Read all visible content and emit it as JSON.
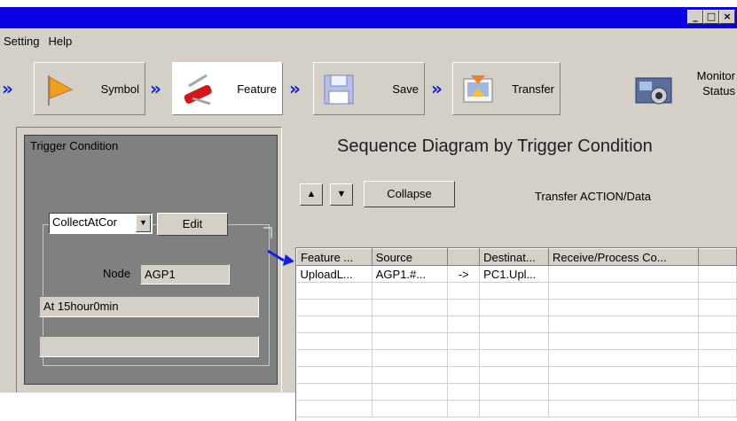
{
  "window": {
    "minimize": "_",
    "maximize": "□",
    "close": "×"
  },
  "menu": [
    "Setting",
    "Help"
  ],
  "flow": {
    "arrow": "»",
    "steps": [
      {
        "label": "Symbol",
        "icon": "flag-icon"
      },
      {
        "label": "Feature",
        "icon": "swiss-knife-icon",
        "active": true
      },
      {
        "label": "Save",
        "icon": "floppy-disk-icon"
      },
      {
        "label": "Transfer",
        "icon": "transfer-icon"
      }
    ],
    "monitor": {
      "line1": "Monitor",
      "line2": "Status",
      "icon": "monitor-camera-icon"
    }
  },
  "trigger": {
    "title": "Trigger Condition",
    "select_value": "CollectAtCor",
    "edit_label": "Edit",
    "node_label": "Node",
    "node_value": "AGP1",
    "time_value": "At 15hour0min",
    "empty_field": ""
  },
  "diagram": {
    "title": "Sequence Diagram by Trigger Condition",
    "up_label": "▲",
    "down_label": "▼",
    "collapse_label": "Collapse",
    "transfer_label": "Transfer ACTION/Data",
    "columns": [
      "Feature ...",
      "Source",
      "",
      "Destinat...",
      "Receive/Process Co...",
      ""
    ],
    "rows": [
      [
        "UploadL...",
        "AGP1.#...",
        "->",
        "PC1.Upl...",
        "",
        ""
      ]
    ],
    "empty_row_count": 8
  },
  "colors": {
    "titlebar": "#0a00e6",
    "accent_arrow": "#1020d8",
    "panel": "#808080"
  }
}
